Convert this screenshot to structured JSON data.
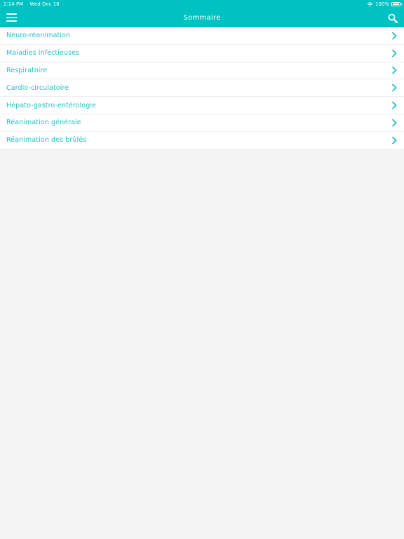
{
  "status_bar": {
    "time": "2:14 PM",
    "date": "Wed Dec 18",
    "battery": "100%"
  },
  "header": {
    "title": "Sommaire",
    "menu_icon": "hamburger-menu-icon",
    "search_icon": "search-icon"
  },
  "list": {
    "items": [
      {
        "label": "Neuro-réanimation"
      },
      {
        "label": "Maladies infectieuses"
      },
      {
        "label": "Respiratoire"
      },
      {
        "label": "Cardio-circulatoire"
      },
      {
        "label": "Hépato-gastro-entérologie"
      },
      {
        "label": "Réanimation générale"
      },
      {
        "label": "Réanimation des brûlés"
      }
    ],
    "chevron_icon": "chevron-right-icon"
  },
  "colors": {
    "accent": "#00c2c2",
    "link_text": "#29bdc6",
    "background": "#f4f4f4"
  }
}
